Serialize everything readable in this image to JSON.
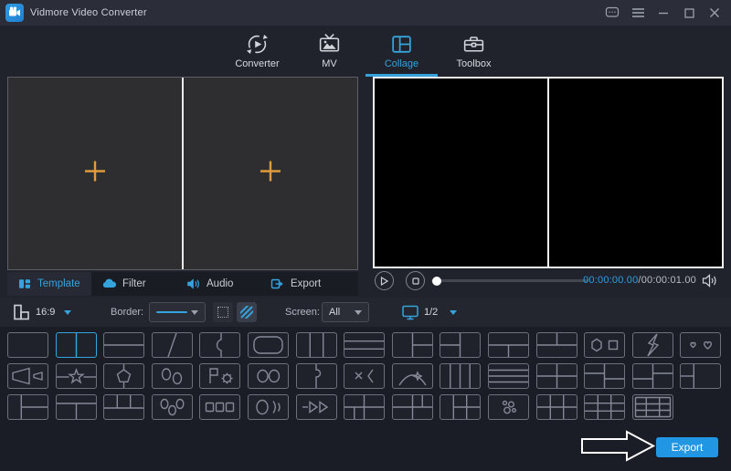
{
  "titlebar": {
    "title": "Vidmore Video Converter",
    "controls": {
      "feedback": "feedback",
      "menu": "menu",
      "minimize": "minimize",
      "maximize": "maximize",
      "close": "close"
    }
  },
  "nav": {
    "tabs": [
      {
        "label": "Converter",
        "icon": "converter-icon",
        "active": false
      },
      {
        "label": "MV",
        "icon": "mv-icon",
        "active": false
      },
      {
        "label": "Collage",
        "icon": "collage-icon",
        "active": true
      },
      {
        "label": "Toolbox",
        "icon": "toolbox-icon",
        "active": false
      }
    ]
  },
  "editor": {
    "cells": [
      {
        "placeholder": "add-video-plus"
      },
      {
        "placeholder": "add-video-plus"
      }
    ]
  },
  "panel_tabs": [
    {
      "label": "Template",
      "icon": "template-icon",
      "active": true
    },
    {
      "label": "Filter",
      "icon": "filter-icon",
      "active": false
    },
    {
      "label": "Audio",
      "icon": "audio-icon",
      "active": false
    },
    {
      "label": "Export",
      "icon": "export-icon",
      "active": false
    }
  ],
  "player": {
    "current_time": "00:00:00.00",
    "separator": "/",
    "total_time": "00:00:01.00",
    "progress_percent": 2
  },
  "toolbar": {
    "aspect_ratio": "16:9",
    "border_label": "Border:",
    "screen_label": "Screen:",
    "screen_value": "All",
    "page_indicator": "1/2"
  },
  "templates": {
    "selected": {
      "row": 0,
      "index": 1
    },
    "rows": [
      [
        "single",
        "two-columns",
        "two-rows",
        "diagonal-split",
        "curve-split",
        "rounded-inset",
        "three-columns",
        "three-rows",
        "left-one-right-two",
        "left-two-right-one",
        "top-one-bottom-two",
        "top-two-bottom-one",
        "hexagon-square",
        "lightning-split",
        "two-hearts"
      ],
      [
        "megaphone",
        "star-split",
        "pentagon-split",
        "two-ovals",
        "flag-gear",
        "two-circles",
        "puzzle-split",
        "cross-bracket",
        "arc-sparkle",
        "four-columns",
        "four-rows",
        "grid-2x2",
        "grid-2x2-offset-a",
        "grid-2x2-offset-b",
        "left-column-split"
      ],
      [
        "narrow-left-right-two",
        "top-row-bottom-two",
        "top-three-bottom-one",
        "three-ovals",
        "three-squares",
        "oval-arcs",
        "double-arrows",
        "grid-mixed-a",
        "grid-mixed-b",
        "grid-mixed-c",
        "scatter-dots",
        "grid-2x3",
        "grid-3x3",
        "grid-3x3-framed"
      ]
    ]
  },
  "footer": {
    "export_label": "Export"
  },
  "colors": {
    "accent": "#35a3dc",
    "plus_orange": "#e09c3c",
    "export_button": "#2196e3",
    "time_current": "#2f9fe0"
  }
}
